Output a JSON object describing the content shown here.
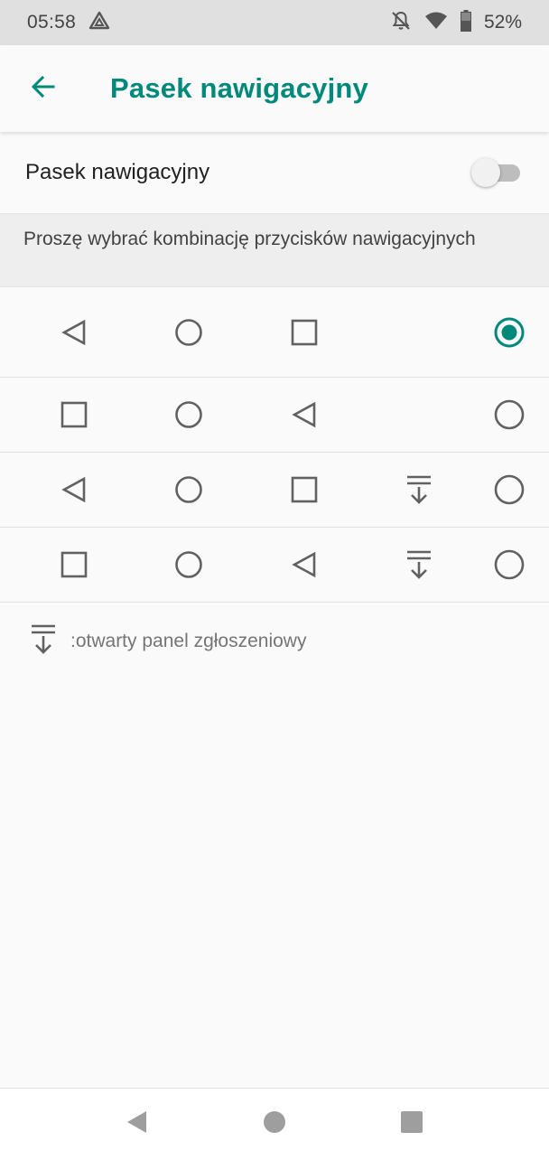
{
  "status_bar": {
    "time": "05:58",
    "battery": "52%",
    "icons": [
      "drive-icon",
      "notifications-off-icon",
      "wifi-icon",
      "battery-icon"
    ]
  },
  "app_bar": {
    "title": "Pasek nawigacyjny",
    "back_icon": "arrow-back-icon"
  },
  "toggle": {
    "label": "Pasek nawigacyjny",
    "enabled": false
  },
  "section_header": "Proszę wybrać kombinację przycisków nawigacyjnych",
  "options": [
    {
      "buttons": [
        "back",
        "home",
        "recents"
      ],
      "selected": true
    },
    {
      "buttons": [
        "recents",
        "home",
        "back"
      ],
      "selected": false
    },
    {
      "buttons": [
        "back",
        "home",
        "recents",
        "notification-panel"
      ],
      "selected": false
    },
    {
      "buttons": [
        "recents",
        "home",
        "back",
        "notification-panel"
      ],
      "selected": false
    }
  ],
  "legend": {
    "icon": "notification-panel-icon",
    "text": ":otwarty panel zgłoszeniowy"
  },
  "nav_bar": {
    "buttons": [
      "back",
      "home",
      "recents"
    ]
  },
  "colors": {
    "accent": "#00897b",
    "icon": "#616161",
    "status_bar_bg": "#e0e0e0"
  }
}
